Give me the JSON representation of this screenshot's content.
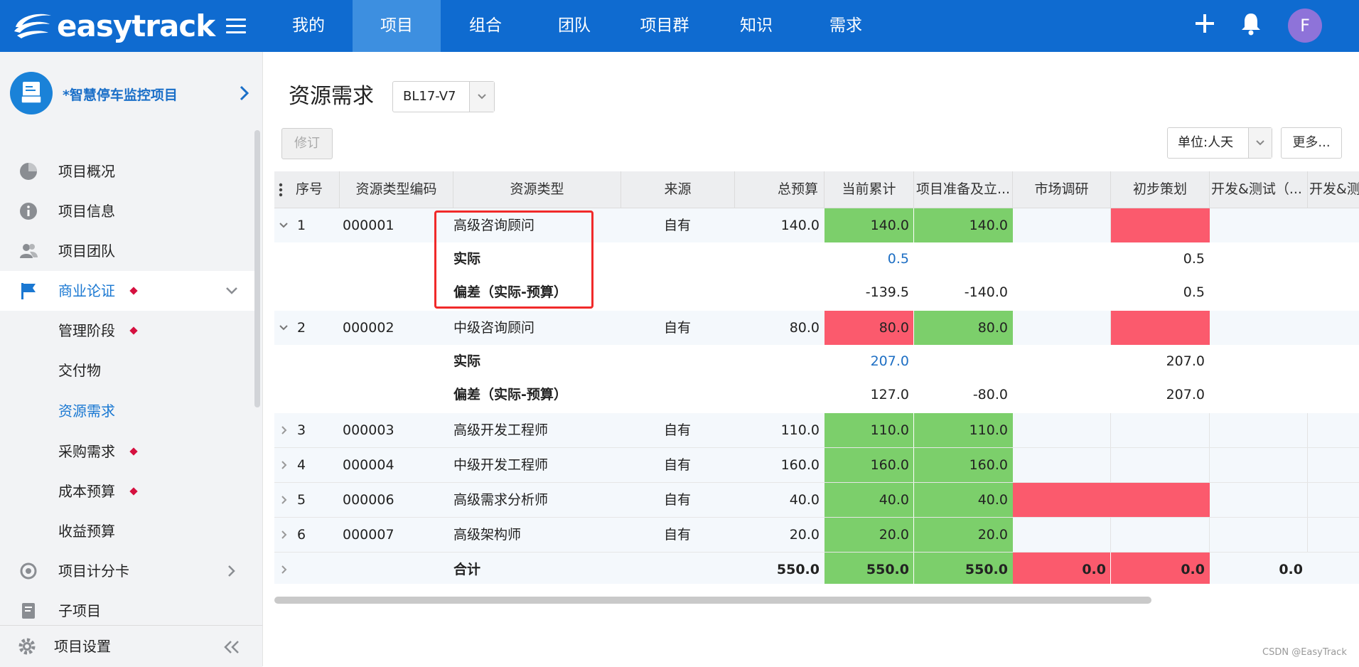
{
  "app": {
    "logo_text": "easytrack"
  },
  "nav": {
    "items": [
      {
        "label": "我的",
        "active": false
      },
      {
        "label": "项目",
        "active": true
      },
      {
        "label": "组合",
        "active": false
      },
      {
        "label": "团队",
        "active": false
      },
      {
        "label": "项目群",
        "active": false
      },
      {
        "label": "知识",
        "active": false
      },
      {
        "label": "需求",
        "active": false
      }
    ]
  },
  "user": {
    "avatar_letter": "F"
  },
  "sidebar": {
    "project_name": "*智慧停车监控项目",
    "items": [
      {
        "label": "项目概况"
      },
      {
        "label": "项目信息"
      },
      {
        "label": "项目团队"
      },
      {
        "label": "商业论证"
      },
      {
        "label": "管理阶段"
      },
      {
        "label": "交付物"
      },
      {
        "label": "资源需求"
      },
      {
        "label": "采购需求"
      },
      {
        "label": "成本预算"
      },
      {
        "label": "收益预算"
      },
      {
        "label": "项目计分卡"
      },
      {
        "label": "子项目"
      }
    ],
    "settings_label": "项目设置"
  },
  "page": {
    "title": "资源需求",
    "version": "BL17-V7",
    "revise_label": "修订",
    "unit_label": "单位:人天",
    "more_label": "更多..."
  },
  "table": {
    "columns": [
      "序号",
      "资源类型编码",
      "资源类型",
      "来源",
      "总预算",
      "当前累计",
      "项目准备及立...",
      "市场调研",
      "初步策划",
      "开发&测试（...",
      "开发&测"
    ],
    "rows": [
      {
        "no": "1",
        "code": "000001",
        "type": "高级咨询顾问",
        "source": "自有",
        "total": "140.0",
        "current": "140.0",
        "prep": "140.0",
        "market": "",
        "plan": "",
        "dev": "",
        "actual": {
          "label": "实际",
          "current": "0.5",
          "prep": "",
          "plan": "0.5"
        },
        "diff": {
          "label": "偏差（实际-预算）",
          "current": "-139.5",
          "prep": "-140.0",
          "plan": "0.5"
        }
      },
      {
        "no": "2",
        "code": "000002",
        "type": "中级咨询顾问",
        "source": "自有",
        "total": "80.0",
        "current": "80.0",
        "prep": "80.0",
        "market": "",
        "plan": "",
        "dev": "",
        "actual": {
          "label": "实际",
          "current": "207.0",
          "prep": "",
          "plan": "207.0"
        },
        "diff": {
          "label": "偏差（实际-预算）",
          "current": "127.0",
          "prep": "-80.0",
          "plan": "207.0"
        }
      },
      {
        "no": "3",
        "code": "000003",
        "type": "高级开发工程师",
        "source": "自有",
        "total": "110.0",
        "current": "110.0",
        "prep": "110.0"
      },
      {
        "no": "4",
        "code": "000004",
        "type": "中级开发工程师",
        "source": "自有",
        "total": "160.0",
        "current": "160.0",
        "prep": "160.0"
      },
      {
        "no": "5",
        "code": "000006",
        "type": "高级需求分析师",
        "source": "自有",
        "total": "40.0",
        "current": "40.0",
        "prep": "40.0"
      },
      {
        "no": "6",
        "code": "000007",
        "type": "高级架构师",
        "source": "自有",
        "total": "20.0",
        "current": "20.0",
        "prep": "20.0"
      }
    ],
    "total_row": {
      "label": "合计",
      "total": "550.0",
      "current": "550.0",
      "prep": "550.0",
      "market": "0.0",
      "plan": "0.0",
      "dev": "0.0"
    }
  },
  "colors": {
    "accent": "#0f6bd0",
    "green": "#7ccf6b",
    "red": "#fb5a6d",
    "highlight": "#f02a2a"
  },
  "watermark": "CSDN @EasyTrack"
}
